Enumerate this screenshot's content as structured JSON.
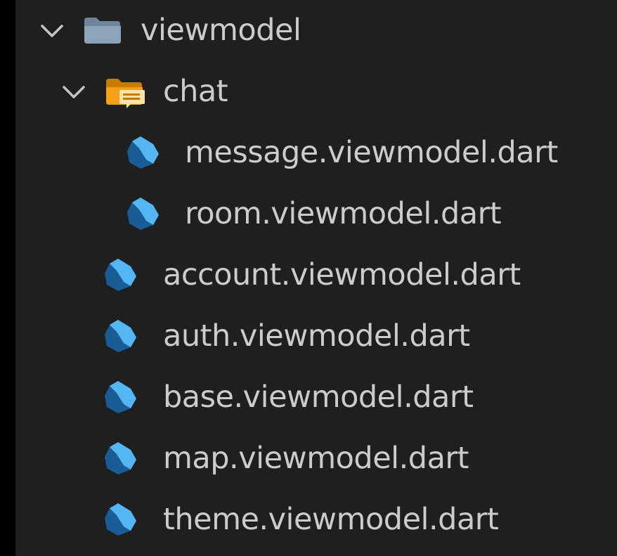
{
  "explorer": {
    "items": [
      {
        "label": "viewmodel",
        "type": "folder",
        "icon": "folder-icon",
        "expanded": true
      },
      {
        "label": "chat",
        "type": "folder",
        "icon": "chat-folder-icon",
        "expanded": true
      },
      {
        "label": "message.viewmodel.dart",
        "type": "file",
        "icon": "dart-file-icon"
      },
      {
        "label": "room.viewmodel.dart",
        "type": "file",
        "icon": "dart-file-icon"
      },
      {
        "label": "account.viewmodel.dart",
        "type": "file",
        "icon": "dart-file-icon"
      },
      {
        "label": "auth.viewmodel.dart",
        "type": "file",
        "icon": "dart-file-icon"
      },
      {
        "label": "base.viewmodel.dart",
        "type": "file",
        "icon": "dart-file-icon"
      },
      {
        "label": "map.viewmodel.dart",
        "type": "file",
        "icon": "dart-file-icon"
      },
      {
        "label": "theme.viewmodel.dart",
        "type": "file",
        "icon": "dart-file-icon"
      }
    ]
  },
  "colors": {
    "background": "#1f1f1f",
    "text": "#cccccc",
    "dart_dark": "#1a5c96",
    "dart_light": "#54b6f2",
    "folder_gray": "#8da3b7",
    "folder_orange": "#f4a017"
  }
}
